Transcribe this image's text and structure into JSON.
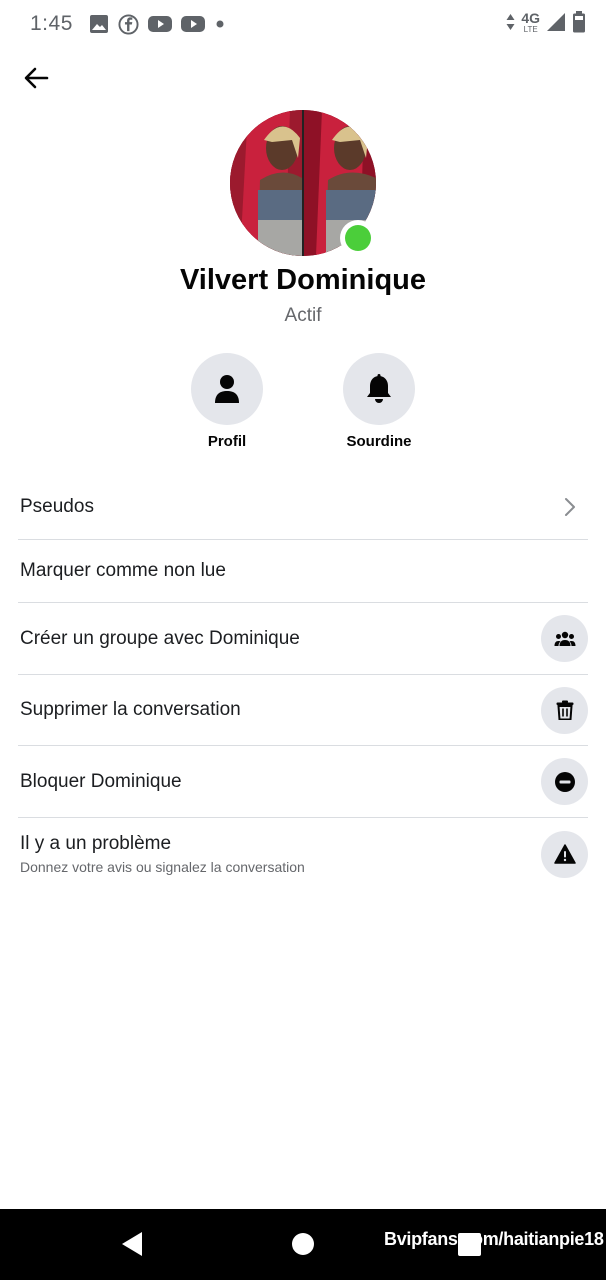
{
  "status_bar": {
    "time": "1:45",
    "network": "4G",
    "network_sub": "LTE",
    "notification_icons": [
      "image-icon",
      "facebook-icon",
      "youtube-icon",
      "youtube-icon",
      "dot-icon"
    ]
  },
  "header": {
    "back_icon": "arrow-left-icon"
  },
  "profile": {
    "name": "Vilvert Dominique",
    "status": "Actif",
    "online_color": "#4bce3a"
  },
  "actions": [
    {
      "label": "Profil",
      "icon": "person-icon"
    },
    {
      "label": "Sourdine",
      "icon": "bell-icon"
    }
  ],
  "menu": [
    {
      "label": "Pseudos",
      "icon": "chevron-right-icon"
    },
    {
      "label": "Marquer comme non lue"
    },
    {
      "label": "Créer un groupe avec Dominique",
      "icon": "group-icon"
    },
    {
      "label": "Supprimer la conversation",
      "icon": "trash-icon"
    },
    {
      "label": "Bloquer Dominique",
      "icon": "block-icon"
    },
    {
      "label": "Il y a un problème",
      "sublabel": "Donnez votre avis ou signalez la conversation",
      "icon": "warning-icon"
    }
  ],
  "nav_bar": {
    "watermark": "Bvipfans.com/haitianpie18"
  },
  "colors": {
    "icon_bg": "#e4e6eb",
    "divider": "#dadde1",
    "secondary_text": "#65676b"
  }
}
